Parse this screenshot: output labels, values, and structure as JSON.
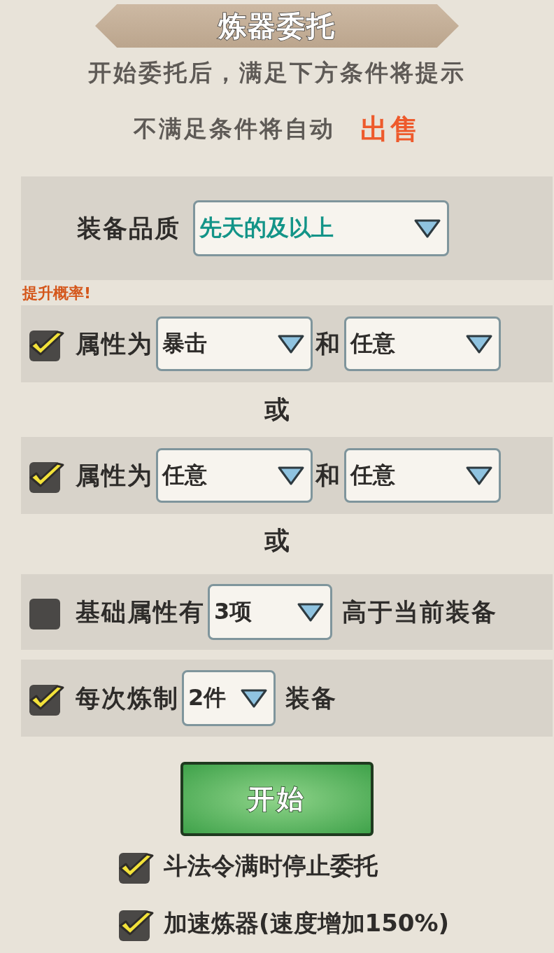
{
  "title": "炼器委托",
  "notice": {
    "line_1": "开始委托后，满足下方条件将提示",
    "line_2": "不满足条件将自动",
    "highlight": "出售"
  },
  "quality": {
    "label": "装备品质",
    "value": "先天的及以上"
  },
  "badge": "提升概率!",
  "rows": [
    {
      "kind": "attribute",
      "checked": true,
      "label": "属性为",
      "first": "暴击",
      "joiner": "和",
      "second": "任意"
    },
    {
      "kind": "separator",
      "text": "或"
    },
    {
      "kind": "attribute",
      "checked": true,
      "label": "属性为",
      "first": "任意",
      "joiner": "和",
      "second": "任意"
    },
    {
      "kind": "separator",
      "text": "或"
    },
    {
      "kind": "threshold",
      "checked": false,
      "label": "基础属性有",
      "value": "3项",
      "suffix": "高于当前装备"
    },
    {
      "kind": "count",
      "checked": true,
      "label": "每次炼制",
      "value": "2件",
      "suffix": "装备"
    }
  ],
  "start_button": "开始",
  "options": [
    {
      "label": "斗法令满时停止委托",
      "checked": true
    },
    {
      "label": "加速炼器(速度增加150%)",
      "checked": true
    }
  ]
}
